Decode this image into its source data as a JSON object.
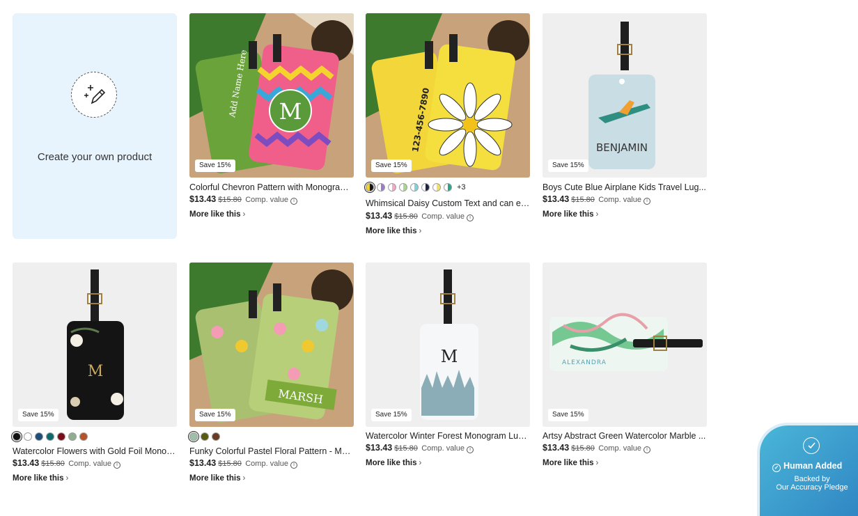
{
  "create": {
    "label": "Create your own product",
    "icon": "magic-pencil-icon"
  },
  "products": [
    {
      "title": "Colorful Chevron Pattern with Monogram...",
      "badge": "Save 15%",
      "price": "$13.43",
      "old_price": "$15.80",
      "comp": "Comp. value",
      "more": "More like this",
      "tag_text": "M",
      "side_text": "Add Name Here"
    },
    {
      "title": "Whimsical Daisy Custom Text and can ed...",
      "badge": "Save 15%",
      "price": "$13.43",
      "old_price": "$15.80",
      "comp": "Comp. value",
      "more": "More like this",
      "more_colors": "+3",
      "tag_text": "123-456-7890"
    },
    {
      "title": "Boys Cute Blue Airplane Kids Travel Lug...",
      "badge": "Save 15%",
      "price": "$13.43",
      "old_price": "$15.80",
      "comp": "Comp. value",
      "more": "More like this",
      "tag_text": "BENJAMIN"
    },
    {
      "title": "Watercolor Flowers with Gold Foil Monog...",
      "badge": "Save 15%",
      "price": "$13.43",
      "old_price": "$15.80",
      "comp": "Comp. value",
      "more": "More like this",
      "tag_text": "M"
    },
    {
      "title": "Funky Colorful Pastel Floral Pattern - Mo...",
      "badge": "Save 15%",
      "price": "$13.43",
      "old_price": "$15.80",
      "comp": "Comp. value",
      "more": "More like this",
      "tag_text": "MARSH"
    },
    {
      "title": "Watercolor Winter Forest Monogram Lug...",
      "badge": "Save 15%",
      "price": "$13.43",
      "old_price": "$15.80",
      "comp": "Comp. value",
      "more": "More like this",
      "tag_text": "M"
    },
    {
      "title": "Artsy Abstract Green Watercolor Marble ...",
      "badge": "Save 15%",
      "price": "$13.43",
      "old_price": "$15.80",
      "comp": "Comp. value",
      "more": "More like this",
      "tag_text": "ALEXANDRA"
    }
  ],
  "swatch_colors": {
    "daisy": [
      "#f0d232",
      "#9a7cc9",
      "#f2a8c6",
      "#a8d88a",
      "#7fd2d8",
      "#1b2540",
      "#f4e060",
      "#2aa58c"
    ],
    "flowers": [
      "#111111",
      "#ffffff",
      "#1f4e79",
      "#0d6b6b",
      "#7a0d1c",
      "#8fae8f",
      "#b5532a"
    ],
    "floral": [
      "#9fc0a8",
      "#5a5a10",
      "#6b3a22"
    ]
  },
  "pledge": {
    "title": "Human Added",
    "line1": "Backed by",
    "line2": "Our Accuracy Pledge",
    "icon": "shield-check-icon"
  }
}
